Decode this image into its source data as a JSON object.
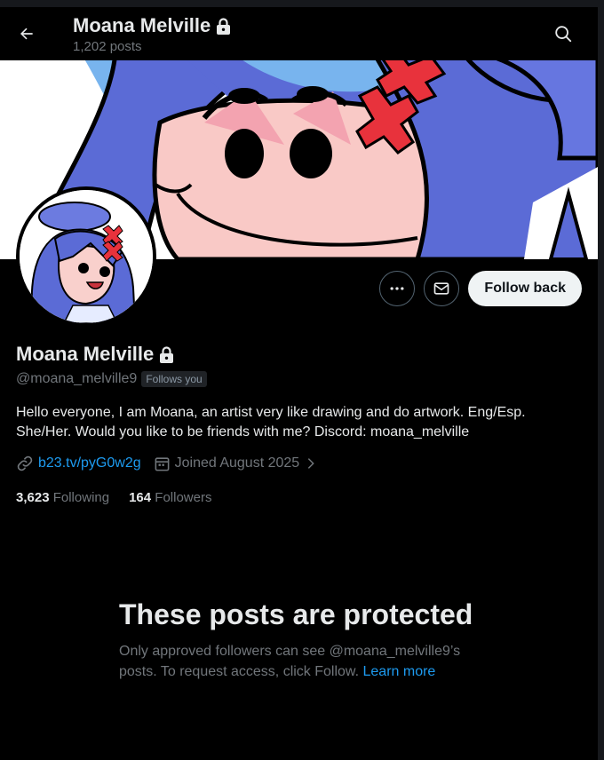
{
  "header": {
    "title": "Moana Melville",
    "post_count": "1,202 posts"
  },
  "profile": {
    "name": "Moana Melville",
    "handle": "@moana_melville9",
    "follows_you_badge": "Follows you",
    "bio": "Hello everyone, I am Moana, an artist very like drawing and do artwork. Eng/Esp. She/Her. Would you like to be friends with me? Discord: moana_melville",
    "link": "b23.tv/pyG0w2g",
    "joined": "Joined August 2025"
  },
  "actions": {
    "follow_back_label": "Follow back"
  },
  "stats": {
    "following_count": "3,623",
    "following_label": "Following",
    "followers_count": "164",
    "followers_label": "Followers"
  },
  "protected": {
    "title": "These posts are protected",
    "desc_prefix": "Only approved followers can see @moana_melville9’s posts. To request access, click Follow.",
    "learn_more": "Learn more"
  },
  "colors": {
    "background": "#000000",
    "accent": "#1d9bf0",
    "muted": "#71767b",
    "follow_button_bg": "#eff3f4"
  },
  "icons": [
    "back-arrow-icon",
    "lock-icon",
    "search-icon",
    "more-icon",
    "message-icon",
    "link-icon",
    "calendar-icon",
    "chevron-right-icon"
  ]
}
